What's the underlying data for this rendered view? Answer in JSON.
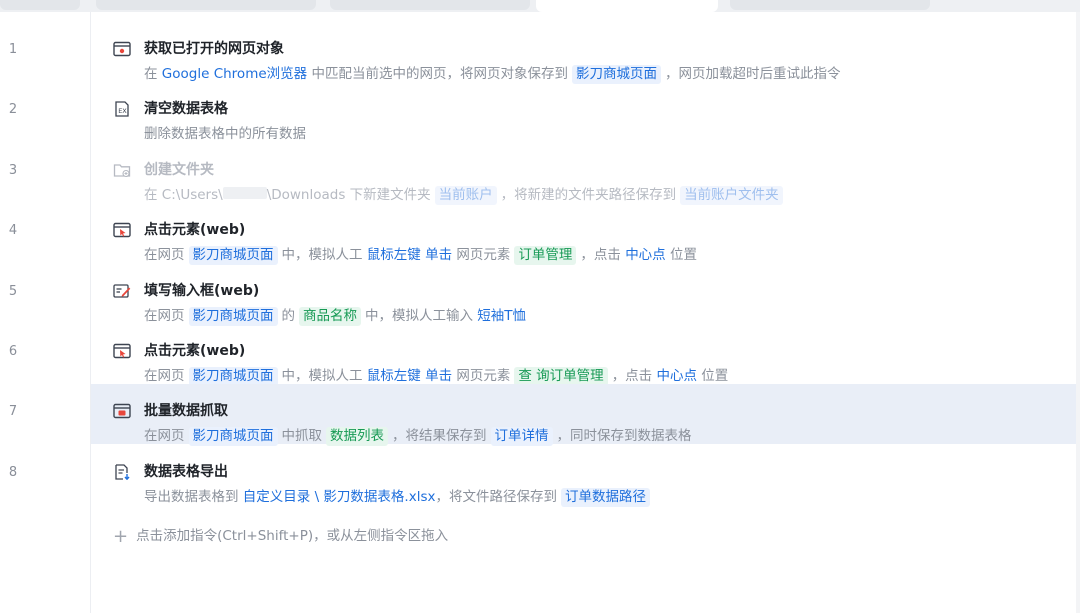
{
  "rows": [
    {
      "num": "1",
      "title": "获取已打开的网页对象",
      "icon": "browser-icon",
      "desc": [
        {
          "t": "在 ",
          "k": "text"
        },
        {
          "t": "Google Chrome浏览器",
          "k": "link"
        },
        {
          "t": " 中匹配当前选中的网页，将网页对象保存到",
          "k": "text"
        },
        {
          "t": "影刀商城页面",
          "k": "blue"
        },
        {
          "t": "，网页加载超时后重试此指令",
          "k": "text"
        }
      ]
    },
    {
      "num": "2",
      "title": "清空数据表格",
      "icon": "excel-clear-icon",
      "desc": [
        {
          "t": "删除数据表格中的所有数据",
          "k": "text"
        }
      ]
    },
    {
      "num": "3",
      "title": "创建文件夹",
      "icon": "folder-add-icon",
      "disabled": true,
      "desc": [
        {
          "t": "在 ",
          "k": "text"
        },
        {
          "t": "C:\\Users\\",
          "k": "link"
        },
        {
          "t": "",
          "k": "mask"
        },
        {
          "t": "\\Downloads",
          "k": "link"
        },
        {
          "t": " 下新建文件夹",
          "k": "text"
        },
        {
          "t": "当前账户",
          "k": "blue"
        },
        {
          "t": "，将新建的文件夹路径保存到",
          "k": "text"
        },
        {
          "t": "当前账户文件夹",
          "k": "blue"
        }
      ]
    },
    {
      "num": "4",
      "title": "点击元素(web)",
      "icon": "click-element-icon",
      "desc": [
        {
          "t": "在网页",
          "k": "text"
        },
        {
          "t": "影刀商城页面",
          "k": "blue"
        },
        {
          "t": "中，模拟人工 ",
          "k": "text"
        },
        {
          "t": "鼠标左键 单击",
          "k": "link"
        },
        {
          "t": " 网页元素",
          "k": "text"
        },
        {
          "t": "订单管理",
          "k": "green"
        },
        {
          "t": "，点击 ",
          "k": "text"
        },
        {
          "t": "中心点",
          "k": "link"
        },
        {
          "t": " 位置",
          "k": "text"
        }
      ]
    },
    {
      "num": "5",
      "title": "填写输入框(web)",
      "icon": "input-fill-icon",
      "desc": [
        {
          "t": "在网页",
          "k": "text"
        },
        {
          "t": "影刀商城页面",
          "k": "blue"
        },
        {
          "t": "的",
          "k": "text"
        },
        {
          "t": "商品名称",
          "k": "green"
        },
        {
          "t": "中，模拟人工输入 ",
          "k": "text"
        },
        {
          "t": "短袖T恤",
          "k": "link"
        }
      ]
    },
    {
      "num": "6",
      "title": "点击元素(web)",
      "icon": "click-element-icon",
      "desc": [
        {
          "t": "在网页",
          "k": "text"
        },
        {
          "t": "影刀商城页面",
          "k": "blue"
        },
        {
          "t": "中，模拟人工 ",
          "k": "text"
        },
        {
          "t": "鼠标左键 单击",
          "k": "link"
        },
        {
          "t": " 网页元素",
          "k": "text"
        },
        {
          "t": "查 询订单管理",
          "k": "green"
        },
        {
          "t": "，点击 ",
          "k": "text"
        },
        {
          "t": "中心点",
          "k": "link"
        },
        {
          "t": " 位置",
          "k": "text"
        }
      ]
    },
    {
      "num": "7",
      "title": "批量数据抓取",
      "icon": "batch-scrape-icon",
      "selected": true,
      "desc": [
        {
          "t": "在网页",
          "k": "text"
        },
        {
          "t": "影刀商城页面",
          "k": "blue"
        },
        {
          "t": "中抓取",
          "k": "text"
        },
        {
          "t": "数据列表",
          "k": "green"
        },
        {
          "t": "，将结果保存到",
          "k": "text"
        },
        {
          "t": "订单详情",
          "k": "blue"
        },
        {
          "t": "，同时保存到数据表格",
          "k": "text"
        }
      ]
    },
    {
      "num": "8",
      "title": "数据表格导出",
      "icon": "table-export-icon",
      "desc": [
        {
          "t": "导出数据表格到 ",
          "k": "text"
        },
        {
          "t": "自定义目录 \\ 影刀数据表格.xlsx",
          "k": "link"
        },
        {
          "t": "，将文件路径保存到",
          "k": "text"
        },
        {
          "t": "订单数据路径",
          "k": "blue"
        }
      ]
    }
  ],
  "add_hint": "点击添加指令(Ctrl+Shift+P)，或从左侧指令区拖入",
  "colors": {
    "accent": "#1f6fdc",
    "green": "#179a55",
    "selected_row": "#e9eef7",
    "icon_red": "#e8473c"
  }
}
